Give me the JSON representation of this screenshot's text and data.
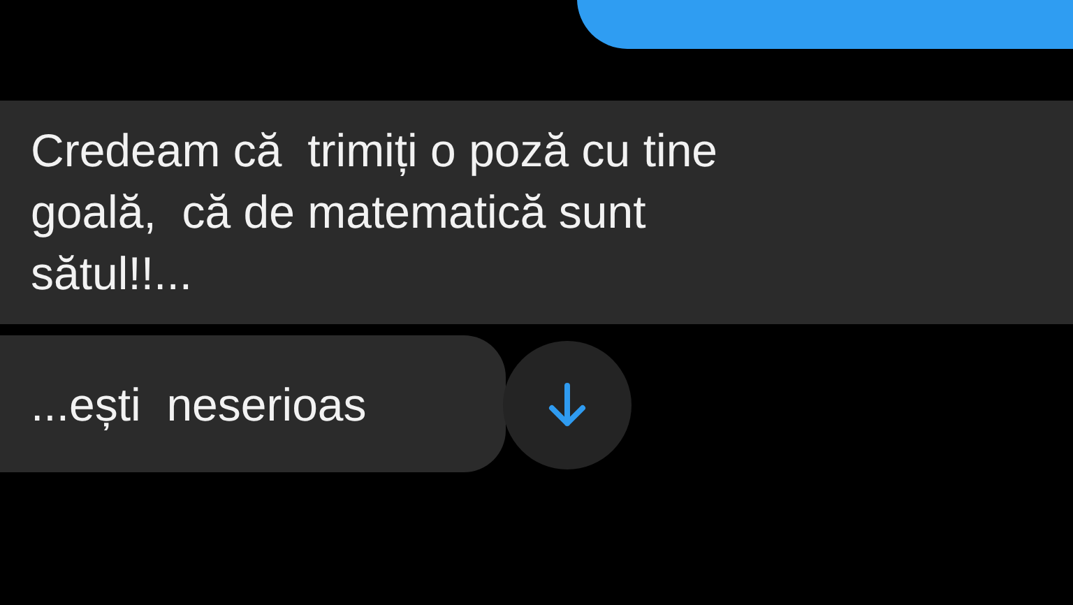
{
  "messages": [
    {
      "kind": "outgoing"
    },
    {
      "kind": "incoming",
      "text": "Credeam că  trimiți o poză cu tine\ngoală,  că de matematică sunt\nsătul!!..."
    },
    {
      "kind": "incoming",
      "text": "...ești  neserioas"
    }
  ],
  "scroll_button": {
    "kind": "down"
  }
}
